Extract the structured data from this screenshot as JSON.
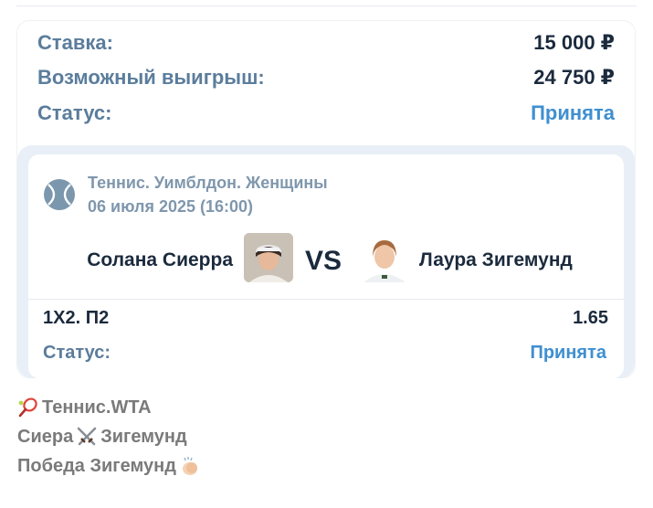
{
  "summary": {
    "stake_label": "Ставка:",
    "stake_value": "15 000 ₽",
    "win_label": "Возможный выигрыш:",
    "win_value": "24 750 ₽",
    "status_label": "Статус:",
    "status_value": "Принята"
  },
  "event": {
    "sport_icon": "tennis-ball-icon",
    "league": "Теннис. Уимблдон. Женщины",
    "date": "06 июля 2025 (16:00)",
    "home": "Солана Сиерра",
    "vs": "VS",
    "away": "Лаура Зигемунд"
  },
  "bet": {
    "market": "1X2. П2",
    "odds": "1.65",
    "status_label": "Статус:",
    "status_value": "Принята"
  },
  "caption": {
    "line1": "Теннис.WTA",
    "line1_icon": "tennis-racket-icon",
    "line2_left": "Сиера",
    "line2_icon": "crossed-swords-icon",
    "line2_right": "Зигемунд",
    "line3": "Победа Зигемунд",
    "line3_icon": "clapping-hands-icon"
  },
  "colors": {
    "accent": "#3f8fd0",
    "label": "#5b7d9c",
    "text": "#1b2a3d",
    "muted": "#7f97ad"
  }
}
